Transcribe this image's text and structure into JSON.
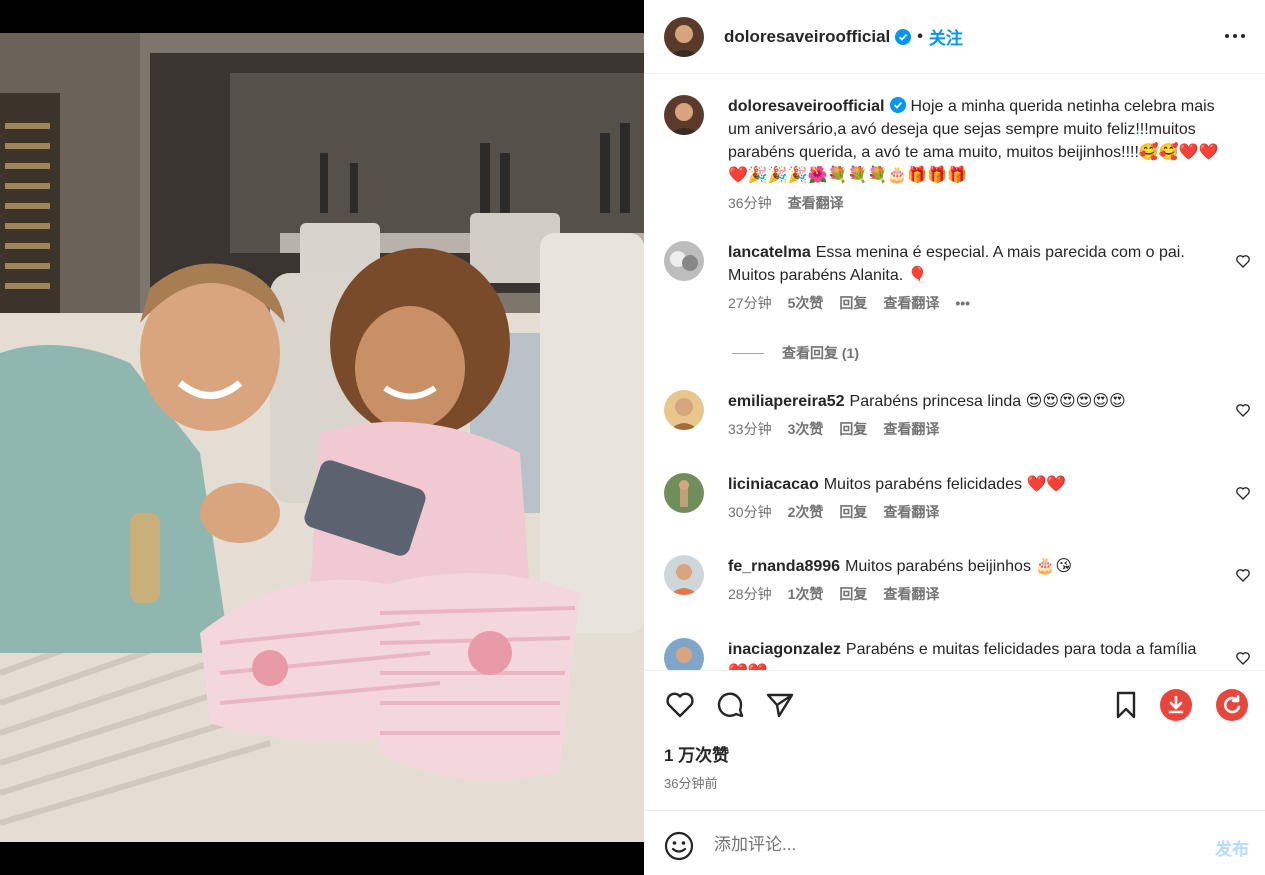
{
  "post": {
    "image_alt": "",
    "author": "doloresaveirooffical",
    "author_display": "doloresaveiroofficial",
    "follow_label": "关注",
    "separator": "•",
    "caption_user": "doloresaveiroofficial",
    "caption_text": "Hoje a minha querida netinha celebra mais um aniversário,a avó deseja que sejas sempre muito feliz!!!muitos parabéns querida, a avó te ama muito, muitos beijinhos!!!!🥰🥰❤️❤️❤️🎉🎉🎉🌺💐💐💐🎂🎁🎁🎁",
    "caption_time": "36分钟",
    "caption_translate": "查看翻译",
    "likes_label": "1 万次赞",
    "posted_ago": "36分钟前"
  },
  "comments": [
    {
      "user": "lancatelma",
      "text": "Essa menina é especial. A mais parecida com o pai. Muitos parabéns Alanita. 🎈",
      "time": "27分钟",
      "likes": "5次赞",
      "reply": "回复",
      "translate": "查看翻译",
      "more": "•••"
    },
    {
      "user": "emiliapereira52",
      "text": "Parabéns princesa linda 😍😍😍😍😍😍",
      "time": "33分钟",
      "likes": "3次赞",
      "reply": "回复",
      "translate": "查看翻译"
    },
    {
      "user": "liciniacacao",
      "text": "Muitos parabéns felicidades ❤️❤️",
      "time": "30分钟",
      "likes": "2次赞",
      "reply": "回复",
      "translate": "查看翻译"
    },
    {
      "user": "fe_rnanda8996",
      "text": "Muitos parabéns beijinhos 🎂😘",
      "time": "28分钟",
      "likes": "1次赞",
      "reply": "回复",
      "translate": "查看翻译"
    },
    {
      "user": "inaciagonzalez",
      "text": "Parabéns e muitas felicidades para toda a família ❤️❤️",
      "time": "",
      "likes": "",
      "reply": "",
      "translate": ""
    }
  ],
  "view_replies": "查看回复 (1)",
  "composer": {
    "placeholder": "添加评论...",
    "post_label": "发布"
  },
  "colors": {
    "accent": "#0095f6",
    "verified": "#0095f6",
    "download_btn": "#e8453c",
    "refresh_btn": "#e8453c"
  },
  "icons": [
    "heart-icon",
    "comment-icon",
    "share-icon",
    "bookmark-icon",
    "download-icon",
    "refresh-icon",
    "emoji-icon",
    "more-icon",
    "verified-icon"
  ]
}
